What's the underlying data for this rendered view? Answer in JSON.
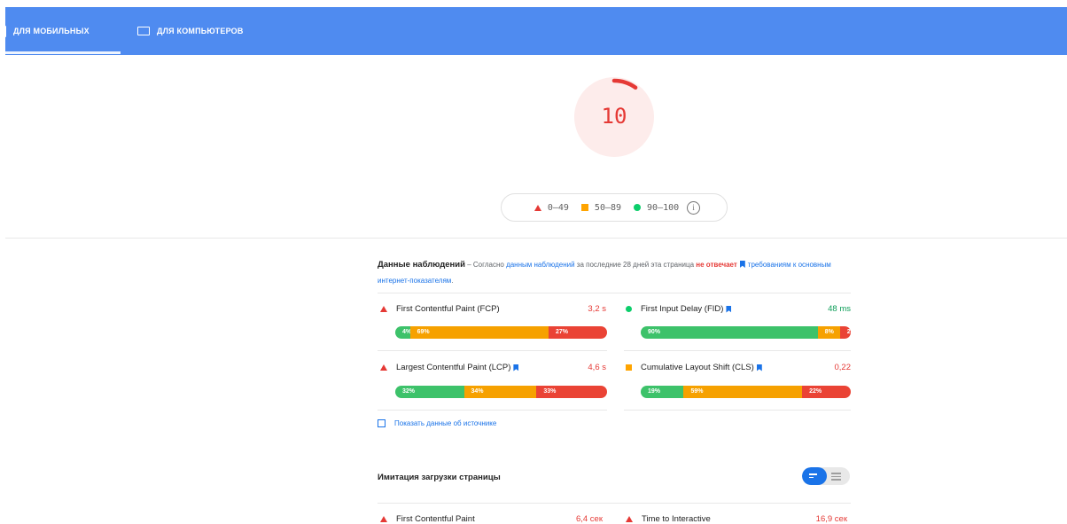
{
  "tabs": [
    {
      "label": "ДЛЯ МОБИЛЬНЫХ",
      "active": true,
      "icon": "smartphone-icon"
    },
    {
      "label": "ДЛЯ КОМПЬЮТЕРОВ",
      "active": false,
      "icon": "laptop-icon"
    }
  ],
  "score": {
    "value": "10",
    "fraction": 0.1,
    "color": "#e53935"
  },
  "legend": [
    {
      "label": "0–49",
      "shape": "triangle",
      "color": "#e53935"
    },
    {
      "label": "50–89",
      "shape": "square",
      "color": "#ffa400"
    },
    {
      "label": "90–100",
      "shape": "circle",
      "color": "#0cce6b"
    }
  ],
  "field_data": {
    "title": "Данные наблюдений",
    "desc_prefix": " – Согласно ",
    "desc_link": "данным наблюдений",
    "desc_mid": " за последние 28 дней эта страница ",
    "desc_bad": "не отвечает",
    "desc_link2": "требованиям к основным интернет-показателям",
    "desc_end": "."
  },
  "metrics": [
    {
      "name": "First Contentful Paint (FCP)",
      "value": "3,2 s",
      "status": "bad",
      "segments": [
        {
          "label": "4%",
          "pct": 4,
          "type": "g"
        },
        {
          "label": "69%",
          "pct": 69,
          "type": "o"
        },
        {
          "label": "27%",
          "pct": 27,
          "type": "r"
        }
      ]
    },
    {
      "name": "First Input Delay (FID)",
      "value": "48 ms",
      "status": "good",
      "segments": [
        {
          "label": "90%",
          "pct": 90,
          "type": "g"
        },
        {
          "label": "8%",
          "pct": 8,
          "type": "o"
        },
        {
          "label": "2%",
          "pct": 2,
          "type": "r"
        }
      ]
    },
    {
      "name": "Largest Contentful Paint (LCP)",
      "value": "4,6 s",
      "status": "bad",
      "segments": [
        {
          "label": "32%",
          "pct": 32,
          "type": "g"
        },
        {
          "label": "34%",
          "pct": 34,
          "type": "o"
        },
        {
          "label": "33%",
          "pct": 33,
          "type": "r"
        }
      ]
    },
    {
      "name": "Cumulative Layout Shift (CLS)",
      "value": "0,22",
      "status": "average",
      "segments": [
        {
          "label": "19%",
          "pct": 19,
          "type": "g"
        },
        {
          "label": "59%",
          "pct": 59,
          "type": "o"
        },
        {
          "label": "22%",
          "pct": 22,
          "type": "r"
        }
      ]
    }
  ],
  "show_source": "Показать данные об источнике",
  "lab": {
    "title": "Имитация загрузки страницы",
    "items": [
      {
        "name": "First Contentful Paint",
        "value": "6,4 сек",
        "status": "bad"
      },
      {
        "name": "Time to Interactive",
        "value": "16,9 сек",
        "status": "bad"
      }
    ]
  },
  "colors": {
    "header": "#4f8bf0",
    "bad": "#e53935",
    "average": "#ffa400",
    "good": "#0cce6b",
    "link": "#1a73e8"
  }
}
